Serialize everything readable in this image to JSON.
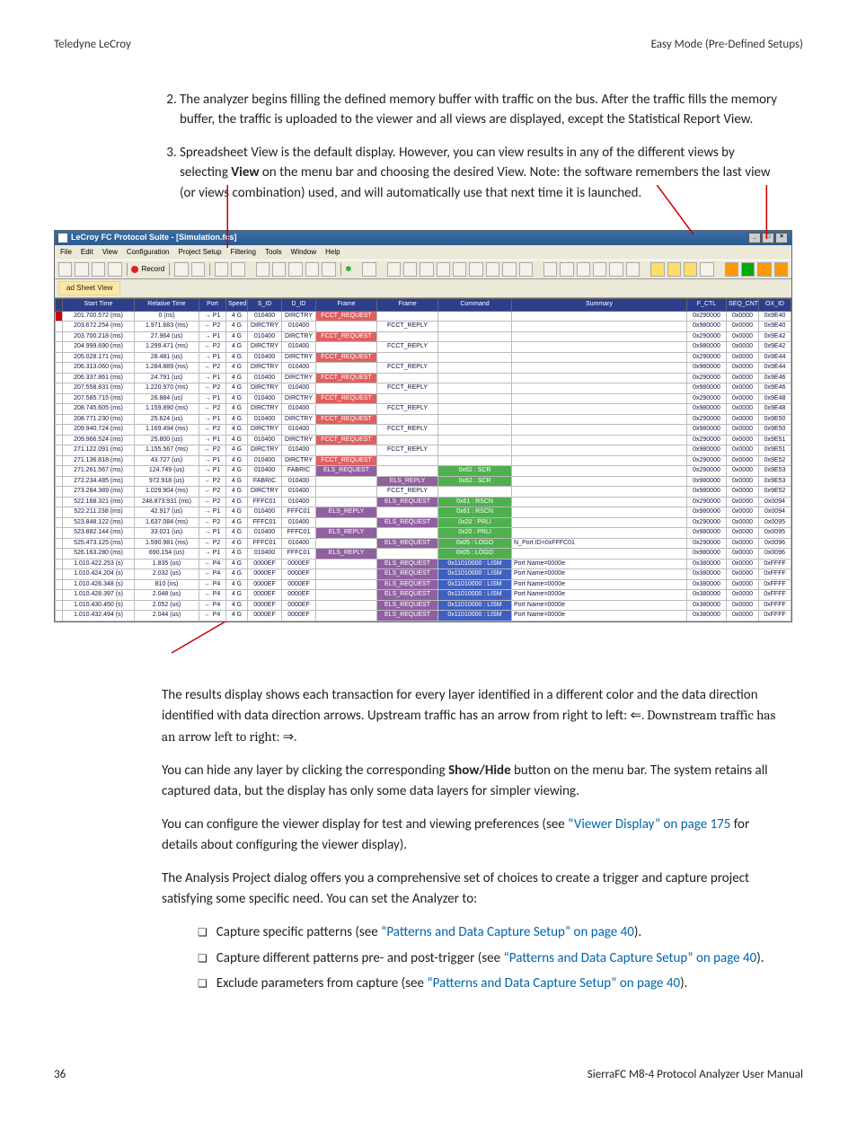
{
  "header": {
    "left": "Teledyne LeCroy",
    "right": "Easy Mode (Pre-Defined Setups)"
  },
  "list_items": [
    "The analyzer begins filling the defined memory buffer with traffic on the bus. After the traffic fills the memory buffer, the traffic is uploaded to the viewer and all views are displayed, except the Statistical Report View.",
    "Spreadsheet View is the default display. However, you can view results in any of the different views by selecting <strong>View</strong> on the menu bar and choosing the desired View. Note: the software remembers the last view (or views combination) used, and will automatically use that next time it is launched."
  ],
  "app": {
    "title": "LeCroy FC Protocol Suite - [Simulation.fcs]",
    "menus": [
      "File",
      "Edit",
      "View",
      "Configuration",
      "Project Setup",
      "Filtering",
      "Tools",
      "Window",
      "Help"
    ],
    "record_label": "Record",
    "tab_label": "ad Sheet View",
    "columns": [
      "",
      "Start Time",
      "Relative Time",
      "Port",
      "Speed",
      "S_ID",
      "D_ID",
      "Frame",
      "Frame",
      "Command",
      "Summary",
      "F_CTL",
      "SEQ_CNT",
      "OX_ID"
    ],
    "rows": [
      {
        "st": "201.700.572 (ms)",
        "rt": "0 (ns)",
        "p": "→ P1",
        "sp": "4 G",
        "sid": "010400",
        "did": "DIRCTRY",
        "f1": "FCCT_REQUEST",
        "f2": "",
        "cmd": "",
        "sum": "",
        "a": "0x290000",
        "b": "0x0000",
        "c": "0x9E40"
      },
      {
        "st": "203.672.254 (ms)",
        "rt": "1.971.683 (ms)",
        "p": "← P2",
        "sp": "4 G",
        "sid": "DIRCTRY",
        "did": "010400",
        "f1": "",
        "f2": "FCCT_REPLY",
        "cmd": "",
        "sum": "",
        "a": "0x980000",
        "b": "0x0000",
        "c": "0x9E40"
      },
      {
        "st": "203.700.218 (ms)",
        "rt": "27.964 (us)",
        "p": "→ P1",
        "sp": "4 G",
        "sid": "010400",
        "did": "DIRCTRY",
        "f1": "FCCT_REQUEST",
        "f2": "",
        "cmd": "",
        "sum": "",
        "a": "0x290000",
        "b": "0x0000",
        "c": "0x9E42"
      },
      {
        "st": "204.999.690 (ms)",
        "rt": "1.299.471 (ms)",
        "p": "← P2",
        "sp": "4 G",
        "sid": "DIRCTRY",
        "did": "010400",
        "f1": "",
        "f2": "FCCT_REPLY",
        "cmd": "",
        "sum": "",
        "a": "0x980000",
        "b": "0x0000",
        "c": "0x9E42"
      },
      {
        "st": "205.028.171 (ms)",
        "rt": "28.481 (us)",
        "p": "→ P1",
        "sp": "4 G",
        "sid": "010400",
        "did": "DIRCTRY",
        "f1": "FCCT_REQUEST",
        "f2": "",
        "cmd": "",
        "sum": "",
        "a": "0x290000",
        "b": "0x0000",
        "c": "0x9E44"
      },
      {
        "st": "206.313.060 (ms)",
        "rt": "1.284.889 (ms)",
        "p": "← P2",
        "sp": "4 G",
        "sid": "DIRCTRY",
        "did": "010400",
        "f1": "",
        "f2": "FCCT_REPLY",
        "cmd": "",
        "sum": "",
        "a": "0x980000",
        "b": "0x0000",
        "c": "0x9E44"
      },
      {
        "st": "206.337.861 (ms)",
        "rt": "24.791 (us)",
        "p": "→ P1",
        "sp": "4 G",
        "sid": "010400",
        "did": "DIRCTRY",
        "f1": "FCCT_REQUEST",
        "f2": "",
        "cmd": "",
        "sum": "",
        "a": "0x290000",
        "b": "0x0000",
        "c": "0x9E46"
      },
      {
        "st": "207.558.831 (ms)",
        "rt": "1.220.970 (ms)",
        "p": "← P2",
        "sp": "4 G",
        "sid": "DIRCTRY",
        "did": "010400",
        "f1": "",
        "f2": "FCCT_REPLY",
        "cmd": "",
        "sum": "",
        "a": "0x980000",
        "b": "0x0000",
        "c": "0x9E46"
      },
      {
        "st": "207.585.715 (ms)",
        "rt": "26.884 (us)",
        "p": "→ P1",
        "sp": "4 G",
        "sid": "010400",
        "did": "DIRCTRY",
        "f1": "FCCT_REQUEST",
        "f2": "",
        "cmd": "",
        "sum": "",
        "a": "0x290000",
        "b": "0x0000",
        "c": "0x9E48"
      },
      {
        "st": "208.745.605 (ms)",
        "rt": "1.159.890 (ms)",
        "p": "← P2",
        "sp": "4 G",
        "sid": "DIRCTRY",
        "did": "010400",
        "f1": "",
        "f2": "FCCT_REPLY",
        "cmd": "",
        "sum": "",
        "a": "0x980000",
        "b": "0x0000",
        "c": "0x9E48"
      },
      {
        "st": "208.771.230 (ms)",
        "rt": "25.624 (us)",
        "p": "→ P1",
        "sp": "4 G",
        "sid": "010400",
        "did": "DIRCTRY",
        "f1": "FCCT_REQUEST",
        "f2": "",
        "cmd": "",
        "sum": "",
        "a": "0x290000",
        "b": "0x0000",
        "c": "0x9E50"
      },
      {
        "st": "209.940.724 (ms)",
        "rt": "1.169.494 (ms)",
        "p": "← P2",
        "sp": "4 G",
        "sid": "DIRCTRY",
        "did": "010400",
        "f1": "",
        "f2": "FCCT_REPLY",
        "cmd": "",
        "sum": "",
        "a": "0x980000",
        "b": "0x0000",
        "c": "0x9E50"
      },
      {
        "st": "209.966.524 (ms)",
        "rt": "25.800 (us)",
        "p": "→ P1",
        "sp": "4 G",
        "sid": "010400",
        "did": "DIRCTRY",
        "f1": "FCCT_REQUEST",
        "f2": "",
        "cmd": "",
        "sum": "",
        "a": "0x290000",
        "b": "0x0000",
        "c": "0x9E51"
      },
      {
        "st": "271.122.091 (ms)",
        "rt": "1.155.567 (ms)",
        "p": "← P2",
        "sp": "4 G",
        "sid": "DIRCTRY",
        "did": "010400",
        "f1": "",
        "f2": "FCCT_REPLY",
        "cmd": "",
        "sum": "",
        "a": "0x980000",
        "b": "0x0000",
        "c": "0x9E51"
      },
      {
        "st": "271.136.818 (ms)",
        "rt": "43.727 (us)",
        "p": "→ P1",
        "sp": "4 G",
        "sid": "010400",
        "did": "DIRCTRY",
        "f1": "FCCT_REQUEST",
        "f2": "",
        "cmd": "",
        "sum": "",
        "a": "0x290000",
        "b": "0x0000",
        "c": "0x9E52"
      },
      {
        "st": "271.261.567 (ms)",
        "rt": "124.749 (us)",
        "p": "→ P1",
        "sp": "4 G",
        "sid": "010400",
        "did": "FABRIC",
        "f1": "ELS_REQUEST",
        "f2": "",
        "cmd": "0x62 : SCR",
        "sum": "",
        "a": "0x290000",
        "b": "0x0000",
        "c": "0x9E53",
        "greencmd": true,
        "purplef1": true
      },
      {
        "st": "272.234.485 (ms)",
        "rt": "972.918 (us)",
        "p": "← P2",
        "sp": "4 G",
        "sid": "FABRIC",
        "did": "010400",
        "f1": "",
        "f2": "ELS_REPLY",
        "cmd": "0x62 : SCR",
        "sum": "",
        "a": "0x980000",
        "b": "0x0000",
        "c": "0x9E53",
        "greencmd": true,
        "purplef2": true
      },
      {
        "st": "273.284.389 (ms)",
        "rt": "1.029.904 (ms)",
        "p": "← P2",
        "sp": "4 G",
        "sid": "DIRCTRY",
        "did": "010400",
        "f1": "",
        "f2": "FCCT_REPLY",
        "cmd": "",
        "sum": "",
        "a": "0x980000",
        "b": "0x0000",
        "c": "0x9E52"
      },
      {
        "st": "522.168.321 (ms)",
        "rt": "248.873.931 (ms)",
        "p": "← P2",
        "sp": "4 G",
        "sid": "FFFC01",
        "did": "010400",
        "f1": "",
        "f2": "ELS_REQUEST",
        "cmd": "0x61 : RSCN",
        "sum": "",
        "a": "0x290000",
        "b": "0x0000",
        "c": "0x0094",
        "greencmd": true,
        "purplef2": true
      },
      {
        "st": "522.211.238 (ms)",
        "rt": "42.917 (us)",
        "p": "→ P1",
        "sp": "4 G",
        "sid": "010400",
        "did": "FFFC01",
        "f1": "ELS_REPLY",
        "f2": "",
        "cmd": "0x61 : RSCN",
        "sum": "",
        "a": "0x980000",
        "b": "0x0000",
        "c": "0x0094",
        "greencmd": true,
        "purplef1": true
      },
      {
        "st": "523.848.122 (ms)",
        "rt": "1.637.084 (ms)",
        "p": "← P2",
        "sp": "4 G",
        "sid": "FFFC01",
        "did": "010400",
        "f1": "",
        "f2": "ELS_REQUEST",
        "cmd": "0x20 : PRLI",
        "sum": "",
        "a": "0x290000",
        "b": "0x0000",
        "c": "0x0095",
        "greencmd": true,
        "purplef2": true
      },
      {
        "st": "523.882.144 (ms)",
        "rt": "33.021 (us)",
        "p": "→ P1",
        "sp": "4 G",
        "sid": "010400",
        "did": "FFFC01",
        "f1": "ELS_REPLY",
        "f2": "",
        "cmd": "0x20 : PRLI",
        "sum": "",
        "a": "0x980000",
        "b": "0x0000",
        "c": "0x0095",
        "greencmd": true,
        "purplef1": true
      },
      {
        "st": "525.473.125 (ms)",
        "rt": "1.590.981 (ms)",
        "p": "← P2",
        "sp": "4 G",
        "sid": "FFFC01",
        "did": "010400",
        "f1": "",
        "f2": "ELS_REQUEST",
        "cmd": "0x05 : LOGO",
        "sum": "N_Port ID=0xFFFC01",
        "a": "0x290000",
        "b": "0x0000",
        "c": "0x0096",
        "greencmd": true,
        "purplef2": true
      },
      {
        "st": "526.163.280 (ms)",
        "rt": "690.154 (us)",
        "p": "→ P1",
        "sp": "4 G",
        "sid": "010400",
        "did": "FFFC01",
        "f1": "ELS_REPLY",
        "f2": "",
        "cmd": "0x05 : LOGO",
        "sum": "",
        "a": "0x980000",
        "b": "0x0000",
        "c": "0x0096",
        "greencmd": true,
        "purplef1": true
      },
      {
        "st": "1.010.422.253 (s)",
        "rt": "1.835 (us)",
        "p": "← P4",
        "sp": "4 G",
        "sid": "0000EF",
        "did": "0000EF",
        "f1": "",
        "f2": "ELS_REQUEST",
        "cmd": "0x11010000 : LISM",
        "sum": "Port Name=0000e",
        "a": "0x380000",
        "b": "0x0000",
        "c": "0xFFFF",
        "bluecmd": true,
        "purplef2": true
      },
      {
        "st": "1.010.424.204 (s)",
        "rt": "2.032 (us)",
        "p": "← P4",
        "sp": "4 G",
        "sid": "0000EF",
        "did": "0000EF",
        "f1": "",
        "f2": "ELS_REQUEST",
        "cmd": "0x11010000 : LISM",
        "sum": "Port Name=0000e",
        "a": "0x380000",
        "b": "0x0000",
        "c": "0xFFFF",
        "bluecmd": true,
        "purplef2": true
      },
      {
        "st": "1.010.426.348 (s)",
        "rt": "810 (ns)",
        "p": "← P4",
        "sp": "4 G",
        "sid": "0000EF",
        "did": "0000EF",
        "f1": "",
        "f2": "ELS_REQUEST",
        "cmd": "0x11010000 : LISM",
        "sum": "Port Name=0000e",
        "a": "0x380000",
        "b": "0x0000",
        "c": "0xFFFF",
        "bluecmd": true,
        "purplef2": true
      },
      {
        "st": "1.010.428.397 (s)",
        "rt": "2.048 (us)",
        "p": "← P4",
        "sp": "4 G",
        "sid": "0000EF",
        "did": "0000EF",
        "f1": "",
        "f2": "ELS_REQUEST",
        "cmd": "0x11010000 : LISM",
        "sum": "Port Name=0000e",
        "a": "0x380000",
        "b": "0x0000",
        "c": "0xFFFF",
        "bluecmd": true,
        "purplef2": true
      },
      {
        "st": "1.010.430.450 (s)",
        "rt": "2.052 (us)",
        "p": "← P4",
        "sp": "4 G",
        "sid": "0000EF",
        "did": "0000EF",
        "f1": "",
        "f2": "ELS_REQUEST",
        "cmd": "0x11010000 : LISM",
        "sum": "Port Name=0000e",
        "a": "0x380000",
        "b": "0x0000",
        "c": "0xFFFF",
        "bluecmd": true,
        "purplef2": true
      },
      {
        "st": "1.010.432.494 (s)",
        "rt": "2.044 (us)",
        "p": "← P4",
        "sp": "4 G",
        "sid": "0000EF",
        "did": "0000EF",
        "f1": "",
        "f2": "ELS_REQUEST",
        "cmd": "0x11010000 : LISM",
        "sum": "Port Name=0000e",
        "a": "0x380000",
        "b": "0x0000",
        "c": "0xFFFF",
        "bluecmd": true,
        "purplef2": true
      }
    ]
  },
  "body": {
    "p1a": "The results display shows each transaction for every layer identified in a different color and the data direction identified with data direction arrows. Upstream traffic has an arrow from right to left: ",
    "p1b": "⇐. Downstream traffic has an arrow left to right: ",
    "p1c": "⇒.",
    "p2": "You can hide any layer by clicking the corresponding <strong>Show/Hide</strong> button on the menu bar. The system retains all captured data, but the display has only some data layers for simpler viewing.",
    "p3a": "You can configure the viewer display for test and viewing preferences (see ",
    "p3link": "“Viewer Display” on page 175",
    "p3b": " for details about configuring the viewer display).",
    "p4": "The Analysis Project dialog offers you a comprehensive set of choices to create a trigger and capture project satisfying some specific need. You can set the Analyzer to:",
    "b1a": "Capture specific patterns (see ",
    "b1link": "“Patterns and Data Capture Setup” on page 40",
    "b1b": ").",
    "b2a": "Capture different patterns pre- and post-trigger (see ",
    "b2link": "“Patterns and Data Capture Setup” on page 40",
    "b2b": ").",
    "b3a": "Exclude parameters from capture (see ",
    "b3link": "“Patterns and Data Capture Setup” on page 40",
    "b3b": ")."
  },
  "footer": {
    "left": "36",
    "right": "SierraFC M8-4 Protocol Analyzer User Manual"
  }
}
